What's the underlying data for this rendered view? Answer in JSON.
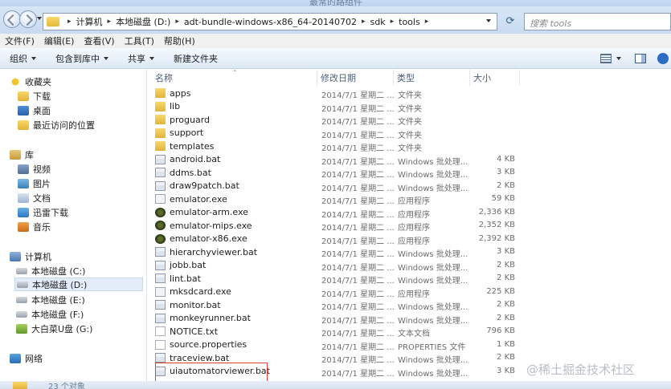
{
  "window": {
    "title_fragment": "最常的路组件"
  },
  "address": {
    "crumbs": [
      "计算机",
      "本地磁盘 (D:)",
      "adt-bundle-windows-x86_64-20140702",
      "sdk",
      "tools"
    ],
    "search_placeholder": "搜索 tools"
  },
  "menu": [
    "文件(F)",
    "编辑(E)",
    "查看(V)",
    "工具(T)",
    "帮助(H)"
  ],
  "toolbar": {
    "organize": "组织",
    "include": "包含到库中",
    "share": "共享",
    "new_folder": "新建文件夹"
  },
  "nav": {
    "favorites": "收藏夹",
    "downloads": "下载",
    "desktop": "桌面",
    "recent": "最近访问的位置",
    "libraries": "库",
    "videos": "视频",
    "pictures": "图片",
    "documents": "文档",
    "xunlei": "迅雷下载",
    "music": "音乐",
    "computer": "计算机",
    "drive_c": "本地磁盘 (C:)",
    "drive_d": "本地磁盘 (D:)",
    "drive_e": "本地磁盘 (E:)",
    "drive_f": "本地磁盘 (F:)",
    "drive_g": "大白菜U盘 (G:)",
    "network": "网络"
  },
  "columns": {
    "name": "名称",
    "date": "修改日期",
    "type": "类型",
    "size": "大小"
  },
  "files": [
    {
      "name": "apps",
      "date": "2014/7/1 星期二 ...",
      "type": "文件夹",
      "size": "",
      "kind": "folder"
    },
    {
      "name": "lib",
      "date": "2014/7/1 星期二 ...",
      "type": "文件夹",
      "size": "",
      "kind": "folder"
    },
    {
      "name": "proguard",
      "date": "2014/7/1 星期二 ...",
      "type": "文件夹",
      "size": "",
      "kind": "folder"
    },
    {
      "name": "support",
      "date": "2014/7/1 星期二 ...",
      "type": "文件夹",
      "size": "",
      "kind": "folder"
    },
    {
      "name": "templates",
      "date": "2014/7/1 星期二 ...",
      "type": "文件夹",
      "size": "",
      "kind": "folder"
    },
    {
      "name": "android.bat",
      "date": "2014/7/1 星期二 ...",
      "type": "Windows 批处理...",
      "size": "4 KB",
      "kind": "bat"
    },
    {
      "name": "ddms.bat",
      "date": "2014/7/1 星期二 ...",
      "type": "Windows 批处理...",
      "size": "3 KB",
      "kind": "bat"
    },
    {
      "name": "draw9patch.bat",
      "date": "2014/7/1 星期二 ...",
      "type": "Windows 批处理...",
      "size": "2 KB",
      "kind": "bat"
    },
    {
      "name": "emulator.exe",
      "date": "2014/7/1 星期二 ...",
      "type": "应用程序",
      "size": "59 KB",
      "kind": "exe"
    },
    {
      "name": "emulator-arm.exe",
      "date": "2014/7/1 星期二 ...",
      "type": "应用程序",
      "size": "2,336 KB",
      "kind": "emu"
    },
    {
      "name": "emulator-mips.exe",
      "date": "2014/7/1 星期二 ...",
      "type": "应用程序",
      "size": "2,352 KB",
      "kind": "emu"
    },
    {
      "name": "emulator-x86.exe",
      "date": "2014/7/1 星期二 ...",
      "type": "应用程序",
      "size": "2,392 KB",
      "kind": "emu"
    },
    {
      "name": "hierarchyviewer.bat",
      "date": "2014/7/1 星期二 ...",
      "type": "Windows 批处理...",
      "size": "3 KB",
      "kind": "bat"
    },
    {
      "name": "jobb.bat",
      "date": "2014/7/1 星期二 ...",
      "type": "Windows 批处理...",
      "size": "2 KB",
      "kind": "bat"
    },
    {
      "name": "lint.bat",
      "date": "2014/7/1 星期二 ...",
      "type": "Windows 批处理...",
      "size": "2 KB",
      "kind": "bat"
    },
    {
      "name": "mksdcard.exe",
      "date": "2014/7/1 星期二 ...",
      "type": "应用程序",
      "size": "225 KB",
      "kind": "exe"
    },
    {
      "name": "monitor.bat",
      "date": "2014/7/1 星期二 ...",
      "type": "Windows 批处理...",
      "size": "2 KB",
      "kind": "bat"
    },
    {
      "name": "monkeyrunner.bat",
      "date": "2014/7/1 星期二 ...",
      "type": "Windows 批处理...",
      "size": "2 KB",
      "kind": "bat"
    },
    {
      "name": "NOTICE.txt",
      "date": "2014/7/1 星期二 ...",
      "type": "文本文档",
      "size": "796 KB",
      "kind": "txt"
    },
    {
      "name": "source.properties",
      "date": "2014/7/1 星期二 ...",
      "type": "PROPERTIES 文件",
      "size": "1 KB",
      "kind": "prop"
    },
    {
      "name": "traceview.bat",
      "date": "2014/7/1 星期二 ...",
      "type": "Windows 批处理...",
      "size": "2 KB",
      "kind": "bat"
    },
    {
      "name": "uiautomatorviewer.bat",
      "date": "2014/7/1 星期二 ...",
      "type": "Windows 批处理...",
      "size": "3 KB",
      "kind": "bat"
    }
  ],
  "status": {
    "text": "23 个对象"
  },
  "watermark": "@稀土掘金技术社区"
}
